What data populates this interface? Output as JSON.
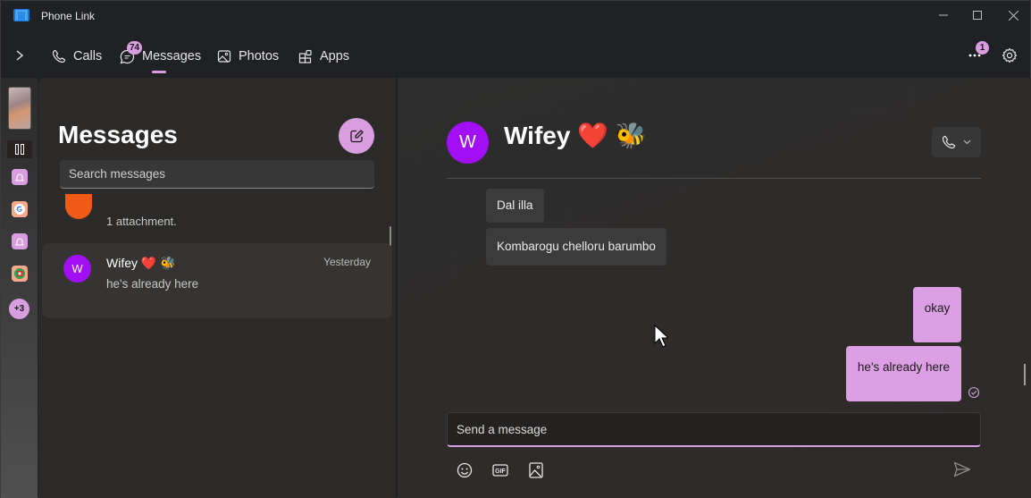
{
  "window": {
    "title": "Phone Link",
    "controls": {
      "minimize": "minimize",
      "maximize": "maximize",
      "close": "close"
    }
  },
  "nav": {
    "tabs": [
      {
        "label": "Calls",
        "icon": "phone-icon"
      },
      {
        "label": "Messages",
        "icon": "chat-icon",
        "badge": "74",
        "active": true
      },
      {
        "label": "Photos",
        "icon": "photo-icon"
      },
      {
        "label": "Apps",
        "icon": "apps-icon"
      }
    ],
    "more_badge": "1"
  },
  "strip": {
    "more_apps": "+3",
    "apps": [
      "notification-app",
      "google-app",
      "notification-app",
      "game-app"
    ]
  },
  "conversations": {
    "title": "Messages",
    "search_placeholder": "Search messages",
    "items": [
      {
        "preview": "1 attachment.",
        "avatar_color": "#f05a14"
      },
      {
        "name": "Wifey ❤️ 🐝",
        "avatar_initial": "W",
        "time": "Yesterday",
        "preview": "he's already here",
        "avatar_color": "#a30ff5",
        "selected": true
      }
    ]
  },
  "chat": {
    "contact_name": "Wifey ❤️ 🐝",
    "avatar_initial": "W",
    "messages": [
      {
        "direction": "incoming",
        "text": "Dal illa"
      },
      {
        "direction": "incoming",
        "text": "Kombarogu chelloru barumbo"
      },
      {
        "direction": "outgoing",
        "text": "okay"
      },
      {
        "direction": "outgoing",
        "text": "he's already here",
        "status": "read"
      }
    ],
    "composer_placeholder": "Send a message",
    "tools": [
      "emoji",
      "gif",
      "image"
    ]
  },
  "colors": {
    "accent": "#d89ee0",
    "avatar_purple": "#a30ff5",
    "avatar_orange": "#f05a14"
  }
}
